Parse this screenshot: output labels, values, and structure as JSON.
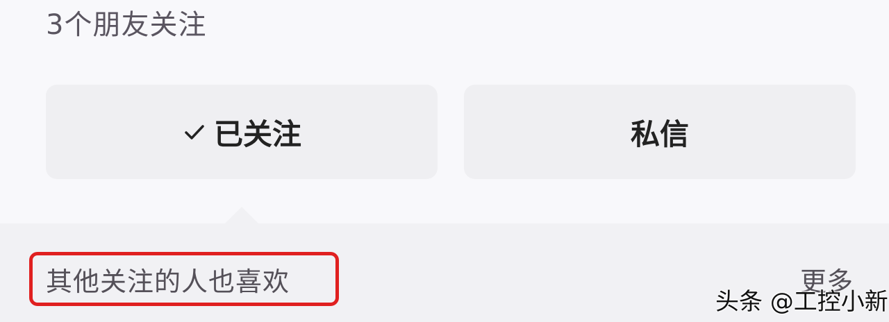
{
  "profile": {
    "friends_follow_text": "3个朋友关注"
  },
  "actions": {
    "follow_label": "已关注",
    "message_label": "私信"
  },
  "recommend": {
    "title": "其他关注的人也喜欢",
    "more_label": "更多",
    "highlight_color": "#e02020"
  },
  "watermark": {
    "text": "头条 @工控小新"
  },
  "icons": {
    "follow_state": "check-icon"
  }
}
